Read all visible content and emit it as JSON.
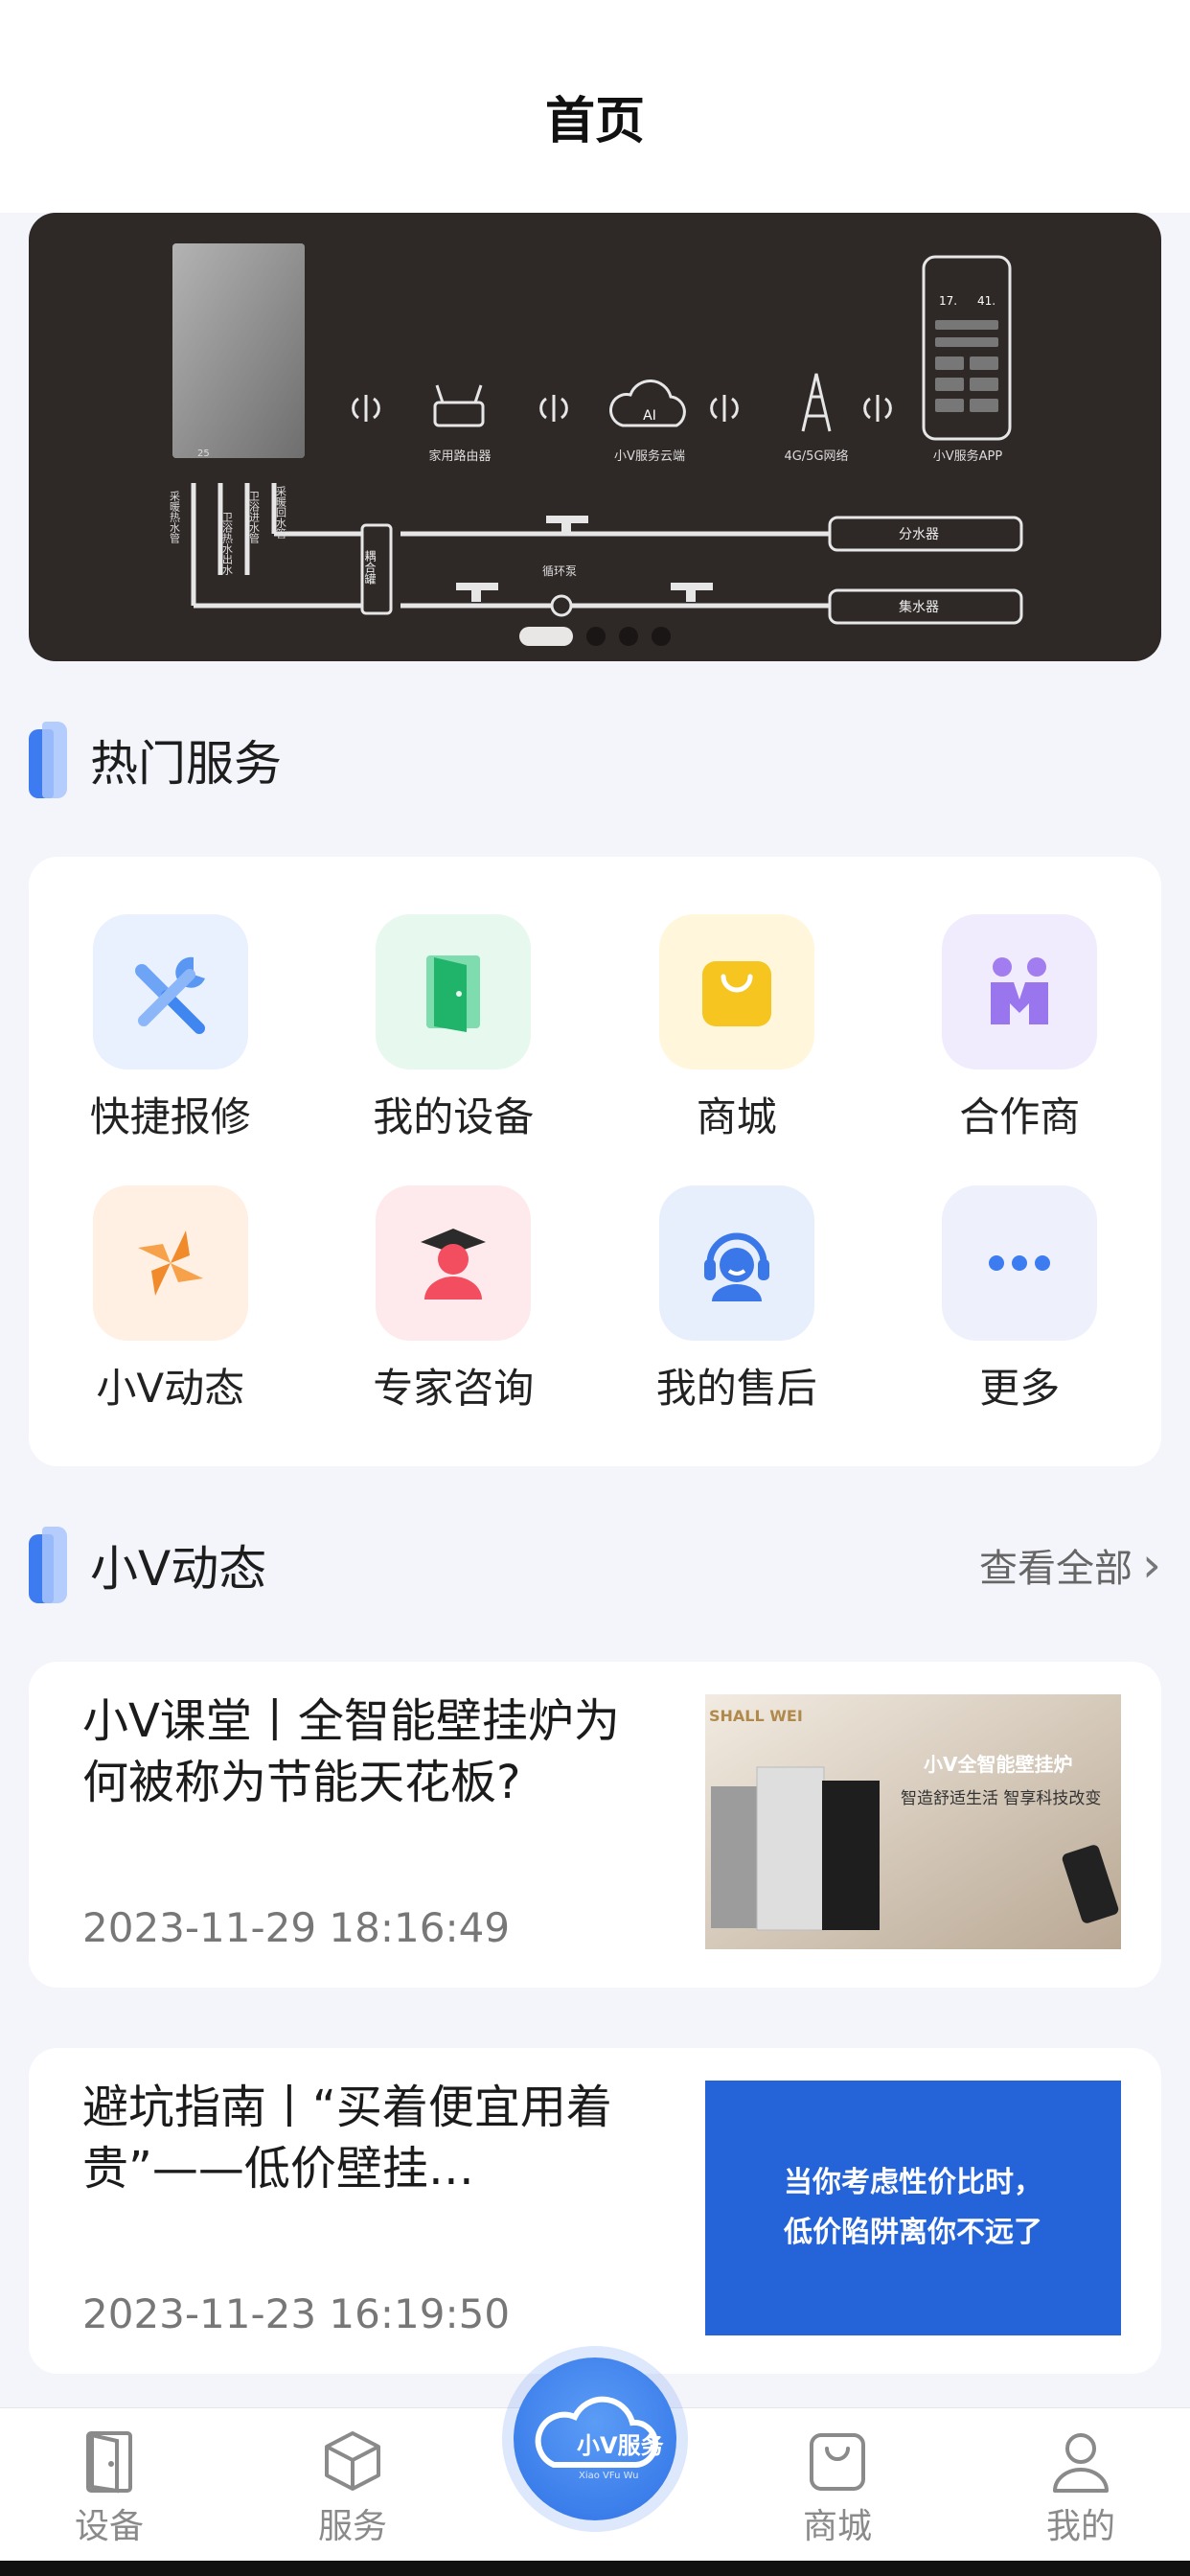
{
  "header": {
    "title": "首页"
  },
  "banner": {
    "labels": {
      "router": "家用路由器",
      "cloud": "小V服务云端",
      "network": "4G/5G网络",
      "app": "小V服务APP",
      "pump": "循环泵",
      "coupler": "耦合罐",
      "distributor": "分水器",
      "collector": "集水器",
      "boiler_display": "25",
      "phone_temp1": "17.",
      "phone_temp2": "41.",
      "pipe1": "采暖热水管",
      "pipe2": "卫浴热水出水",
      "pipe3": "卫浴进水管",
      "pipe4": "采暖回水管"
    },
    "pages": 4,
    "active_page": 1
  },
  "hot_services": {
    "title": "热门服务",
    "items": [
      {
        "label": "快捷报修",
        "icon": "tools-icon"
      },
      {
        "label": "我的设备",
        "icon": "door-icon"
      },
      {
        "label": "商城",
        "icon": "shopping-bag-icon"
      },
      {
        "label": "合作商",
        "icon": "partners-icon"
      },
      {
        "label": "小V动态",
        "icon": "pinwheel-icon"
      },
      {
        "label": "专家咨询",
        "icon": "graduate-icon"
      },
      {
        "label": "我的售后",
        "icon": "headset-icon"
      },
      {
        "label": "更多",
        "icon": "more-dots-icon"
      }
    ]
  },
  "news": {
    "title": "小V动态",
    "view_all": "查看全部",
    "items": [
      {
        "title": "小V课堂丨全智能壁挂炉为何被称为节能天花板?",
        "date": "2023-11-29 18:16:49",
        "image_text": {
          "brand": "SHALL WEI",
          "headline": "小V全智能壁挂炉",
          "subline": "智造舒适生活  智享科技改变"
        }
      },
      {
        "title": "避坑指南丨“买着便宜用着贵”——低价壁挂…",
        "date": "2023-11-23 16:19:50",
        "image_text": {
          "line1": "当你考虑性价比时，",
          "line2": "低价陷阱离你不远了"
        }
      }
    ]
  },
  "tabbar": {
    "items": [
      {
        "label": "设备",
        "icon": "door-icon"
      },
      {
        "label": "服务",
        "icon": "cube-icon"
      },
      {
        "label": "商城",
        "icon": "shopping-bag-icon"
      },
      {
        "label": "我的",
        "icon": "person-icon"
      }
    ],
    "center": {
      "text": "小V服务",
      "subtext": "Xiao VFu Wu",
      "icon": "cloud-icon"
    }
  },
  "colors": {
    "accent": "#3d7cf0",
    "banner_bg": "#2e2827",
    "page_bg": "#f4f5fa"
  }
}
